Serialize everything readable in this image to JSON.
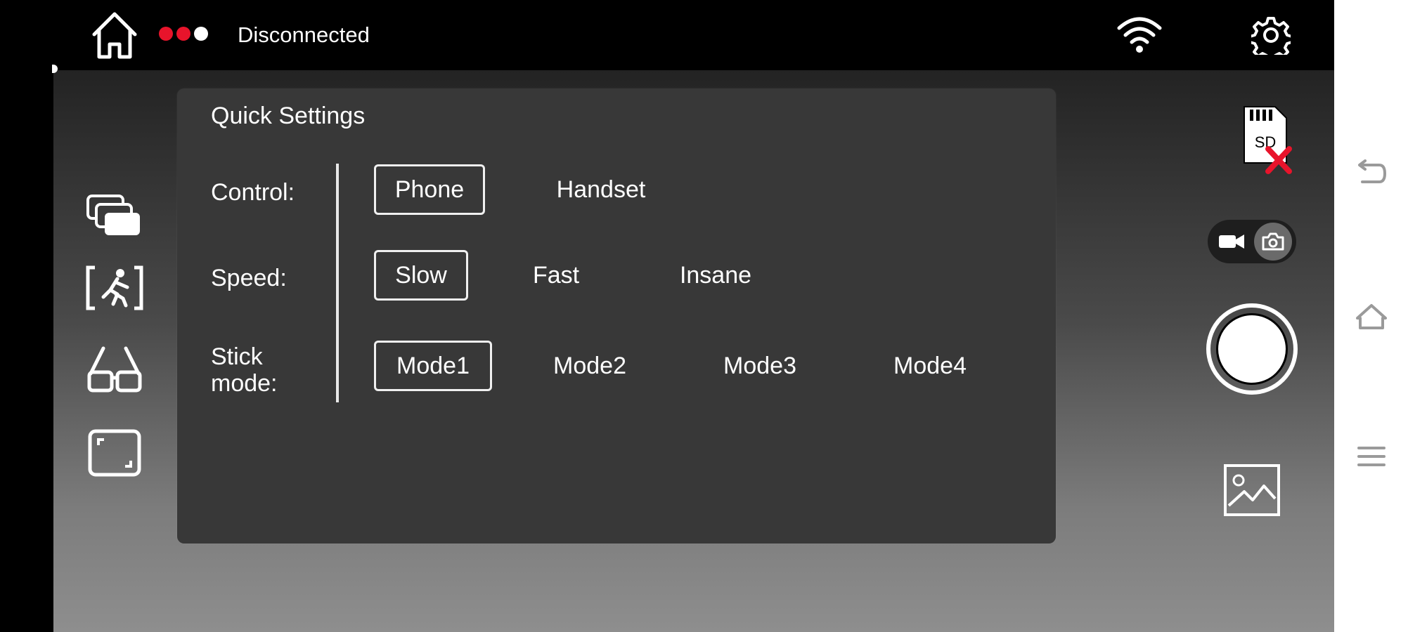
{
  "status": {
    "text": "Disconnected",
    "dots": [
      {
        "color": "#e8142b"
      },
      {
        "color": "#e8142b"
      },
      {
        "color": "#ffffff"
      }
    ]
  },
  "top_bar": {
    "icons": [
      "home-icon",
      "wifi-icon",
      "gear-icon"
    ]
  },
  "left_toolbar": {
    "icons": [
      "gallery-stack-icon",
      "tracking-icon",
      "vr-glasses-icon",
      "fullscreen-icon"
    ]
  },
  "quick_settings": {
    "title": "Quick Settings",
    "rows": [
      {
        "label": "Control:",
        "options": [
          "Phone",
          "Handset"
        ],
        "selected": "Phone"
      },
      {
        "label": "Speed:",
        "options": [
          "Slow",
          "Fast",
          "Insane"
        ],
        "selected": "Slow"
      },
      {
        "label_line1": "Stick",
        "label_line2": "mode:",
        "options": [
          "Mode1",
          "Mode2",
          "Mode3",
          "Mode4"
        ],
        "selected": "Mode1"
      }
    ]
  },
  "right_toolbar": {
    "sd_card_text": "SD",
    "sd_status_color": "#e8142b",
    "capture_mode": "photo",
    "icons": [
      "sd-card-icon",
      "video-icon",
      "camera-icon",
      "shutter-icon",
      "gallery-icon"
    ]
  },
  "android_nav": {
    "icons": [
      "back-icon",
      "home-icon",
      "menu-icon"
    ]
  }
}
